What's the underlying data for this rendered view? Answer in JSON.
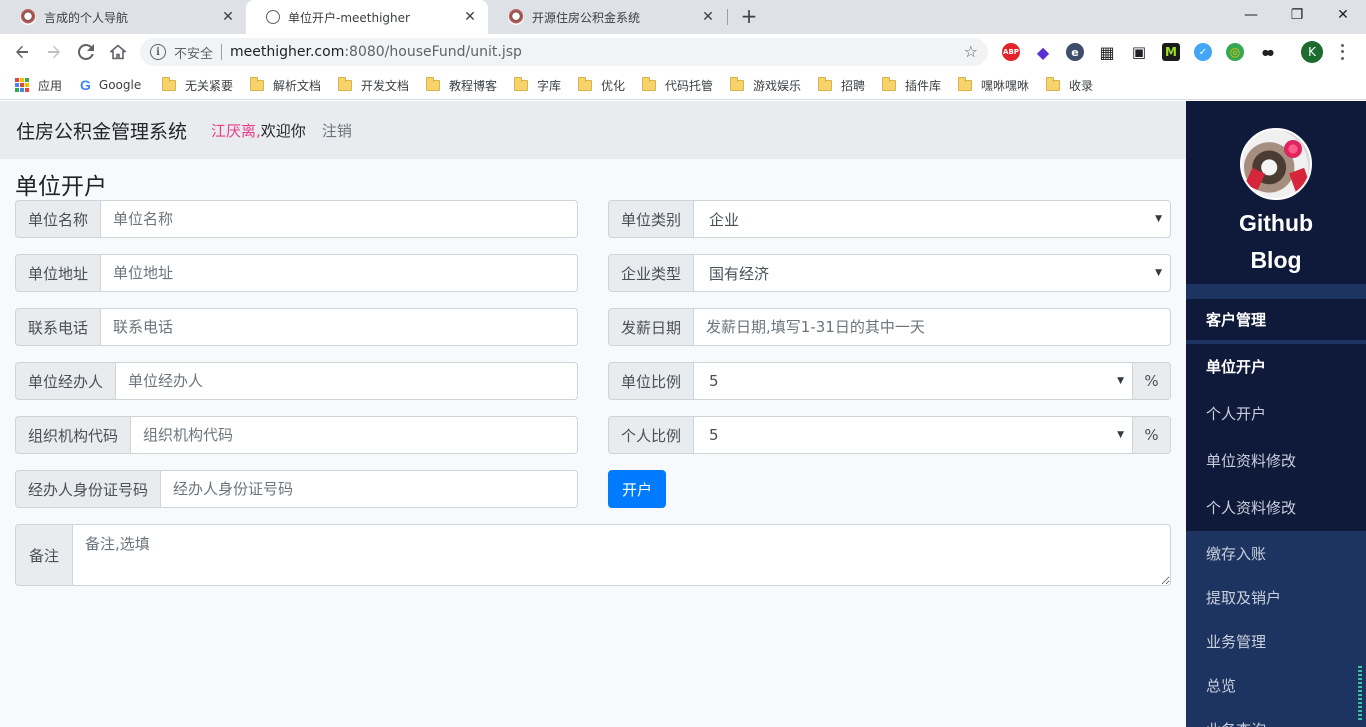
{
  "browser": {
    "tabs": [
      {
        "title": "言成的个人导航",
        "icon": "sheep-favicon-icon",
        "active": false
      },
      {
        "title": "单位开户-meethigher",
        "icon": "globe-icon",
        "active": true
      },
      {
        "title": "开源住房公积金系统",
        "icon": "sheep-favicon-icon",
        "active": false
      }
    ],
    "new_tab": "+",
    "window": {
      "minimize": "—",
      "restore": "❐",
      "close": "✕"
    },
    "address": {
      "security_label": "不安全",
      "host": "meethigher.com",
      "path": ":8080/houseFund/unit.jsp"
    },
    "profile_initial": "K",
    "extensions": [
      {
        "name": "adblock-plus-icon",
        "label": "ABP",
        "color": "#e3242b"
      },
      {
        "name": "diamond-extension-icon",
        "label": "◆",
        "color": "#5b2fd6"
      },
      {
        "name": "edge-reader-icon",
        "label": "e",
        "color": "#3f4e6b"
      },
      {
        "name": "qr-code-icon",
        "label": "▦",
        "color": "#202124"
      },
      {
        "name": "picture-in-picture-icon",
        "label": "▣",
        "color": "#202124"
      },
      {
        "name": "m-extension-icon",
        "label": "M",
        "color": "#2e7d32"
      },
      {
        "name": "check-extension-icon",
        "label": "✓",
        "color": "#42a5f5"
      },
      {
        "name": "swirl-extension-icon",
        "label": "◎",
        "color": "#fbbc04"
      },
      {
        "name": "sunglasses-extension-icon",
        "label": "●●",
        "color": "#202124"
      }
    ],
    "bookmarks": [
      {
        "label": "应用",
        "type": "apps"
      },
      {
        "label": "Google",
        "type": "google"
      },
      {
        "label": "无关紧要",
        "type": "folder"
      },
      {
        "label": "解析文档",
        "type": "folder"
      },
      {
        "label": "开发文档",
        "type": "folder"
      },
      {
        "label": "教程博客",
        "type": "folder"
      },
      {
        "label": "字库",
        "type": "folder"
      },
      {
        "label": "优化",
        "type": "folder"
      },
      {
        "label": "代码托管",
        "type": "folder"
      },
      {
        "label": "游戏娱乐",
        "type": "folder"
      },
      {
        "label": "招聘",
        "type": "folder"
      },
      {
        "label": "插件库",
        "type": "folder"
      },
      {
        "label": "嘿咻嘿咻",
        "type": "folder"
      },
      {
        "label": "收录",
        "type": "folder"
      }
    ]
  },
  "header": {
    "app_title": "住房公积金管理系统",
    "user_name": "江厌离,",
    "welcome": "欢迎你",
    "logout": "注销"
  },
  "form": {
    "heading": "单位开户",
    "unit_name": {
      "label": "单位名称",
      "placeholder": "单位名称",
      "value": ""
    },
    "unit_address": {
      "label": "单位地址",
      "placeholder": "单位地址",
      "value": ""
    },
    "phone": {
      "label": "联系电话",
      "placeholder": "联系电话",
      "value": ""
    },
    "agent": {
      "label": "单位经办人",
      "placeholder": "单位经办人",
      "value": ""
    },
    "org_code": {
      "label": "组织机构代码",
      "placeholder": "组织机构代码",
      "value": ""
    },
    "agent_id": {
      "label": "经办人身份证号码",
      "placeholder": "经办人身份证号码",
      "value": ""
    },
    "unit_category": {
      "label": "单位类别",
      "selected": "企业"
    },
    "enterprise_type": {
      "label": "企业类型",
      "selected": "国有经济"
    },
    "pay_date": {
      "label": "发薪日期",
      "placeholder": "发薪日期,填写1-31日的其中一天",
      "value": ""
    },
    "unit_ratio": {
      "label": "单位比例",
      "selected": "5",
      "suffix": "%"
    },
    "personal_ratio": {
      "label": "个人比例",
      "selected": "5",
      "suffix": "%"
    },
    "submit_label": "开户",
    "memo": {
      "label": "备注",
      "placeholder": "备注,选填",
      "value": ""
    }
  },
  "sidebar": {
    "brand_line1": "Github",
    "brand_line2": "Blog",
    "group_title": "客户管理",
    "sub_items": [
      {
        "label": "单位开户",
        "active": true
      },
      {
        "label": "个人开户",
        "active": false
      },
      {
        "label": "单位资料修改",
        "active": false
      },
      {
        "label": "个人资料修改",
        "active": false
      }
    ],
    "main_items": [
      {
        "label": "缴存入账"
      },
      {
        "label": "提取及销户"
      },
      {
        "label": "业务管理"
      },
      {
        "label": "总览"
      },
      {
        "label": "业务查询"
      }
    ]
  },
  "colors": {
    "primary": "#007bff",
    "user_name": "#e83e8c",
    "sidebar_dark": "#0f1a3a",
    "sidebar": "#1d3461"
  }
}
